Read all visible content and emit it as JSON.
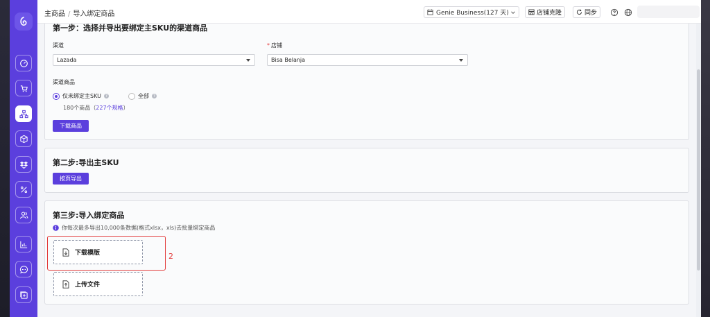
{
  "header": {
    "breadcrumb": [
      "主商品",
      "导入绑定商品"
    ],
    "business_select": "Genie Business(127 天)",
    "store_clone_label": "店铺克隆",
    "sync_label": "同步"
  },
  "step1": {
    "title": "第一步：选择并导出要绑定主SKU的渠道商品",
    "channel_label": "渠道",
    "channel_value": "Lazada",
    "store_label": "店铺",
    "store_required_mark": "*",
    "store_value": "Bisa Belanja",
    "channel_products_label": "渠道商品",
    "radio_unbound_label": "仅未绑定主SKU",
    "radio_all_label": "全部",
    "count_prefix": "180个商品（",
    "count_link": "227个规格",
    "count_suffix": "）",
    "download_button": "下载商品"
  },
  "step2": {
    "title": "第二步:导出主SKU",
    "export_button": "按页导出"
  },
  "step3": {
    "title": "第三步:导入绑定商品",
    "info_text": "你每次最多导出10,000条数据(格式xlsx，xls)去批量绑定商品",
    "download_template_label": "下载模版",
    "upload_file_label": "上传文件",
    "highlight_number": "2"
  },
  "colors": {
    "brand": "#5b3fdd",
    "highlight": "#e23a3a"
  },
  "sidebar_icons": [
    "dashboard-icon",
    "cart-icon",
    "hierarchy-icon",
    "cube-icon",
    "dropbox-icon",
    "percent-icon",
    "users-icon",
    "chart-icon",
    "chat-icon",
    "plus-square-icon"
  ]
}
